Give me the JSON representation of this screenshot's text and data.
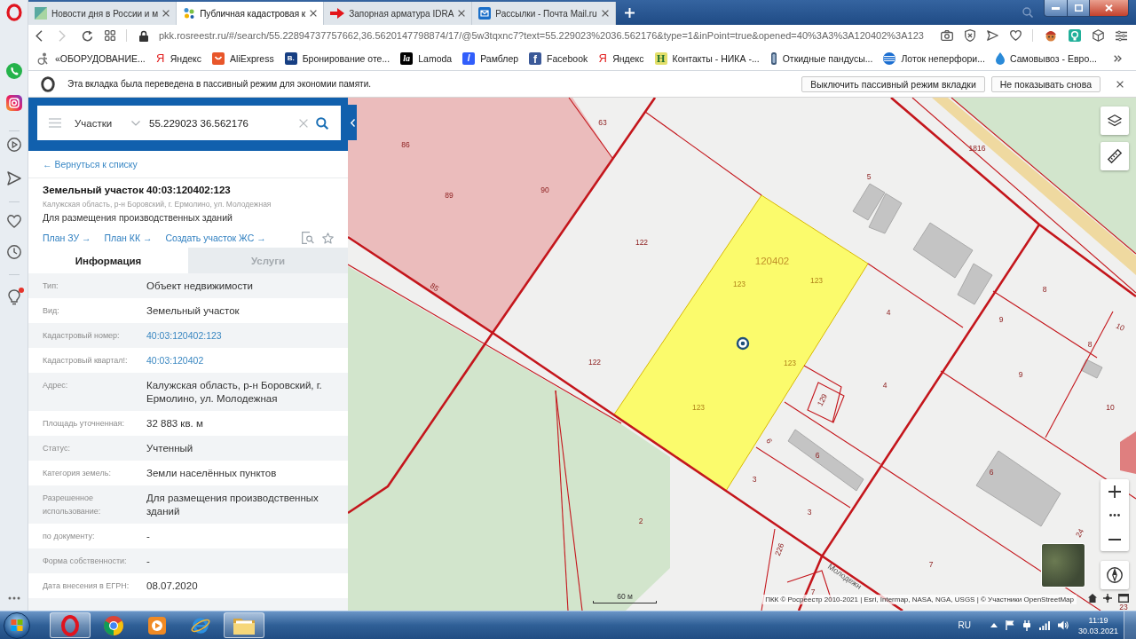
{
  "browser": {
    "tabs": [
      {
        "kind": "news",
        "title": "Новости дня в России и м",
        "selected": false
      },
      {
        "kind": "cadastre",
        "title": "Публичная кадастровая к",
        "selected": true
      },
      {
        "kind": "arrow",
        "title": "Запорная арматура IDRA",
        "selected": false
      },
      {
        "kind": "mail",
        "title": "Рассылки - Почта Mail.ru",
        "selected": false
      }
    ],
    "address_bar": {
      "url": "pkk.rosreestr.ru/#/search/55.22894737757662,36.5620147798874/17/@5w3tqxnc7?text=55.229023%2036.562176&type=1&inPoint=true&opened=40%3A3%3A120402%3A123",
      "forward_disabled": true
    },
    "bookmarks": [
      {
        "kind": "figure",
        "label": "«ОБОРУДОВАНИЕ..."
      },
      {
        "kind": "yandex",
        "glyph": "Я",
        "label": "Яндекс"
      },
      {
        "kind": "smile",
        "label": "AliExpress"
      },
      {
        "kind": "booking",
        "glyph": "B.",
        "label": "Бронирование оте..."
      },
      {
        "kind": "lamoda",
        "glyph": "la",
        "label": "Lamoda"
      },
      {
        "kind": "rambler",
        "glyph": "/",
        "label": "Рамблер"
      },
      {
        "kind": "facebook",
        "glyph": "f",
        "label": "Facebook"
      },
      {
        "kind": "yandex",
        "glyph": "Я",
        "label": "Яндекс"
      },
      {
        "kind": "nika",
        "glyph": "H",
        "label": "Контакты - НИКА -..."
      },
      {
        "kind": "bottle",
        "label": "Откидные пандусы..."
      },
      {
        "kind": "globe",
        "label": "Лоток неперфори..."
      },
      {
        "kind": "drop",
        "label": "Самовывоз - Евро..."
      }
    ],
    "notice": {
      "text": "Эта вкладка была переведена в пассивный режим для экономии памяти.",
      "buttons": [
        "Выключить пассивный режим вкладки",
        "Не показывать снова"
      ]
    }
  },
  "sidebar": {
    "tips_badge": true
  },
  "panel": {
    "search": {
      "layer": "Участки",
      "value": "55.229023 36.562176"
    },
    "back_link": "← Вернуться к списку",
    "title": "Земельный участок 40:03:120402:123",
    "address": "Калужская область, р-н Боровский, г. Ермолино, ул. Молодежная",
    "purpose": "Для размещения производственных зданий",
    "links": [
      "План ЗУ →",
      "План КК →",
      "Создать участок ЖС →"
    ],
    "tabs": [
      {
        "label": "Информация",
        "selected": true
      },
      {
        "label": "Услуги",
        "selected": false
      }
    ],
    "rows": [
      {
        "kind": "text",
        "label": "Тип:",
        "value": "Объект недвижимости"
      },
      {
        "kind": "text",
        "label": "Вид:",
        "value": "Земельный участок"
      },
      {
        "kind": "link",
        "label": "Кадастровый номер:",
        "value": "40:03:120402:123"
      },
      {
        "kind": "link",
        "label": "Кадастровый квартал!:",
        "value": "40:03:120402"
      },
      {
        "kind": "text",
        "label": "Адрес:",
        "value": "Калужская область, р-н Боровский, г. Ермолино, ул. Молодежная"
      },
      {
        "kind": "text",
        "label": "Площадь уточненная:",
        "value": "32 883 кв. м"
      },
      {
        "kind": "text",
        "label": "Статус:",
        "value": "Учтенный"
      },
      {
        "kind": "text",
        "label": "Категория земель:",
        "value": "Земли населённых пунктов"
      },
      {
        "kind": "text",
        "label": "Разрешенное использование:",
        "value": "Для размещения производственных зданий"
      },
      {
        "kind": "text",
        "label": "по документу:",
        "value": "-"
      },
      {
        "kind": "text",
        "label": "Форма собственности:",
        "value": "-"
      },
      {
        "kind": "text",
        "label": "Дата внесения в ЕГРН:",
        "value": "08.07.2020"
      }
    ]
  },
  "map": {
    "block_number": "120402",
    "parcel_numbers": [
      "86",
      "89",
      "90",
      "63",
      "85",
      "122",
      "122",
      "5",
      "1816",
      "4",
      "4",
      "129",
      "6",
      "6",
      "6",
      "3",
      "3",
      "8",
      "8",
      "9",
      "9",
      "10",
      "10",
      "2",
      "226",
      "7",
      "7",
      "24",
      "23"
    ],
    "selected_parcel_numbers": [
      "123",
      "123",
      "123",
      "123"
    ],
    "street": "Молодежн",
    "scale": "60 м",
    "attribution": "ПКК © Росреестр 2010-2021 | Esri, Intermap, NASA, NGA, USGS | © Участники OpenStreetMap"
  },
  "taskbar": {
    "apps": [
      {
        "kind": "opera",
        "running": true
      },
      {
        "kind": "chrome",
        "running": false
      },
      {
        "kind": "media",
        "running": false
      },
      {
        "kind": "ie",
        "running": false
      },
      {
        "kind": "explorer",
        "running": true
      }
    ],
    "language": "RU",
    "time": "11:19",
    "date": "30.03.2021"
  }
}
